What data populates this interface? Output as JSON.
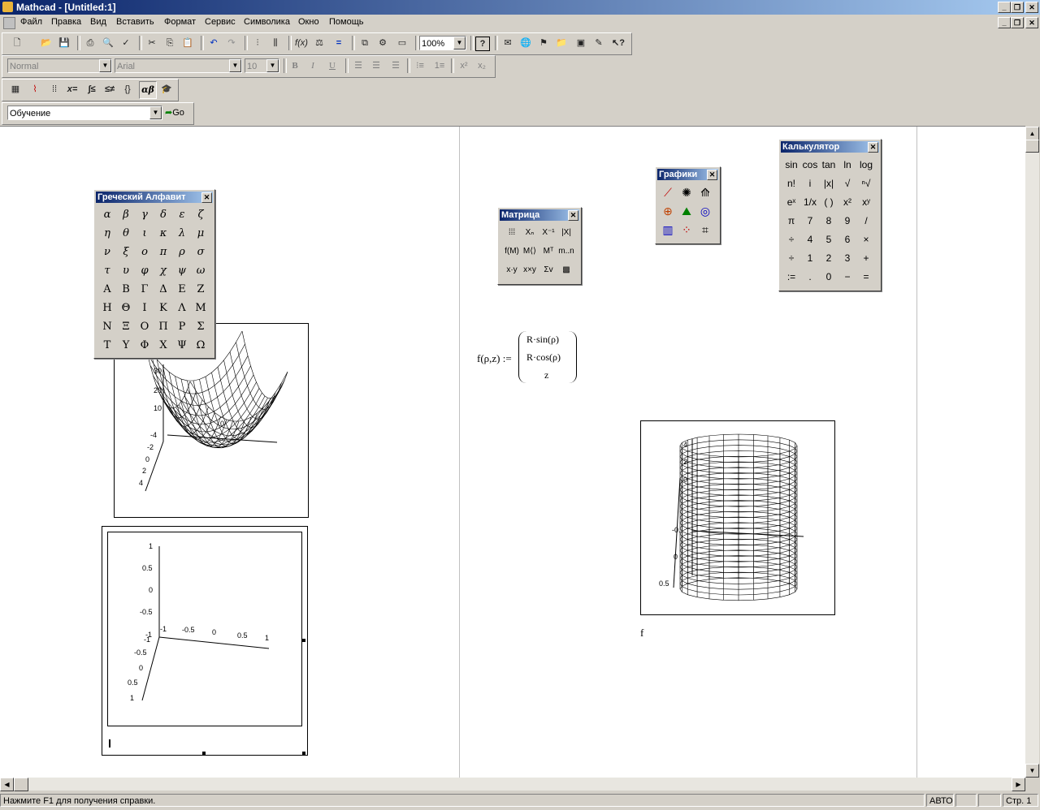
{
  "window": {
    "title": "Mathcad - [Untitled:1]"
  },
  "menu": [
    "Файл",
    "Правка",
    "Вид",
    "Вставить",
    "Формат",
    "Сервис",
    "Символика",
    "Окно",
    "Помощь"
  ],
  "toolbar": {
    "zoom": "100%"
  },
  "format_toolbar": {
    "style": "Normal",
    "font": "Arial",
    "size": "10"
  },
  "resource_bar": {
    "value": "Обучение",
    "go_label": "Go"
  },
  "greek_palette": {
    "title": "Греческий Алфавит",
    "rows": [
      [
        "α",
        "β",
        "γ",
        "δ",
        "ε",
        "ζ"
      ],
      [
        "η",
        "θ",
        "ι",
        "κ",
        "λ",
        "μ"
      ],
      [
        "ν",
        "ξ",
        "ο",
        "π",
        "ρ",
        "σ"
      ],
      [
        "τ",
        "υ",
        "φ",
        "χ",
        "ψ",
        "ω"
      ],
      [
        "Α",
        "Β",
        "Γ",
        "Δ",
        "Ε",
        "Ζ"
      ],
      [
        "Η",
        "Θ",
        "Ι",
        "Κ",
        "Λ",
        "Μ"
      ],
      [
        "Ν",
        "Ξ",
        "Ο",
        "Π",
        "Ρ",
        "Σ"
      ],
      [
        "Τ",
        "Υ",
        "Φ",
        "Χ",
        "Ψ",
        "Ω"
      ]
    ]
  },
  "matrix_palette": {
    "title": "Матрица"
  },
  "graph_palette": {
    "title": "Графики"
  },
  "calculator": {
    "title": "Калькулятор",
    "rows": [
      [
        "sin",
        "cos",
        "tan",
        "ln",
        "log"
      ],
      [
        "n!",
        "i",
        "|x|",
        "√",
        "ⁿ√"
      ],
      [
        "eˣ",
        "1/x",
        "( )",
        "x²",
        "xʸ"
      ],
      [
        "π",
        "7",
        "8",
        "9",
        "/"
      ],
      [
        "÷",
        "4",
        "5",
        "6",
        "×"
      ],
      [
        "÷",
        "1",
        "2",
        "3",
        "+"
      ],
      [
        ":=",
        ".",
        "0",
        "−",
        "="
      ]
    ]
  },
  "plot1": {
    "z_ticks": [
      "30",
      "20",
      "10"
    ],
    "y_ticks": [
      "-4",
      "-2",
      "0",
      "2",
      "4"
    ],
    "x_tick": "0"
  },
  "plot2": {
    "z_ticks": [
      "1",
      "0.5",
      "0",
      "-0.5",
      "-1"
    ],
    "x_ticks": [
      "-1",
      "-0.5",
      "0",
      "0.5",
      "1"
    ],
    "y_ticks": [
      "-1",
      "-0.5",
      "0",
      "0.5",
      "1"
    ]
  },
  "equation": {
    "lhs": "f(ρ,z) :=",
    "rows": [
      "R·sin(ρ)",
      "R·cos(ρ)",
      "z"
    ]
  },
  "plot3": {
    "z_ticks": [
      "4",
      "2",
      "0",
      "-0.",
      "0",
      "0.5"
    ],
    "label": "f"
  },
  "status": {
    "help": "Нажмите F1 для получения справки.",
    "mode": "АВТО",
    "page": "Стр. 1"
  }
}
